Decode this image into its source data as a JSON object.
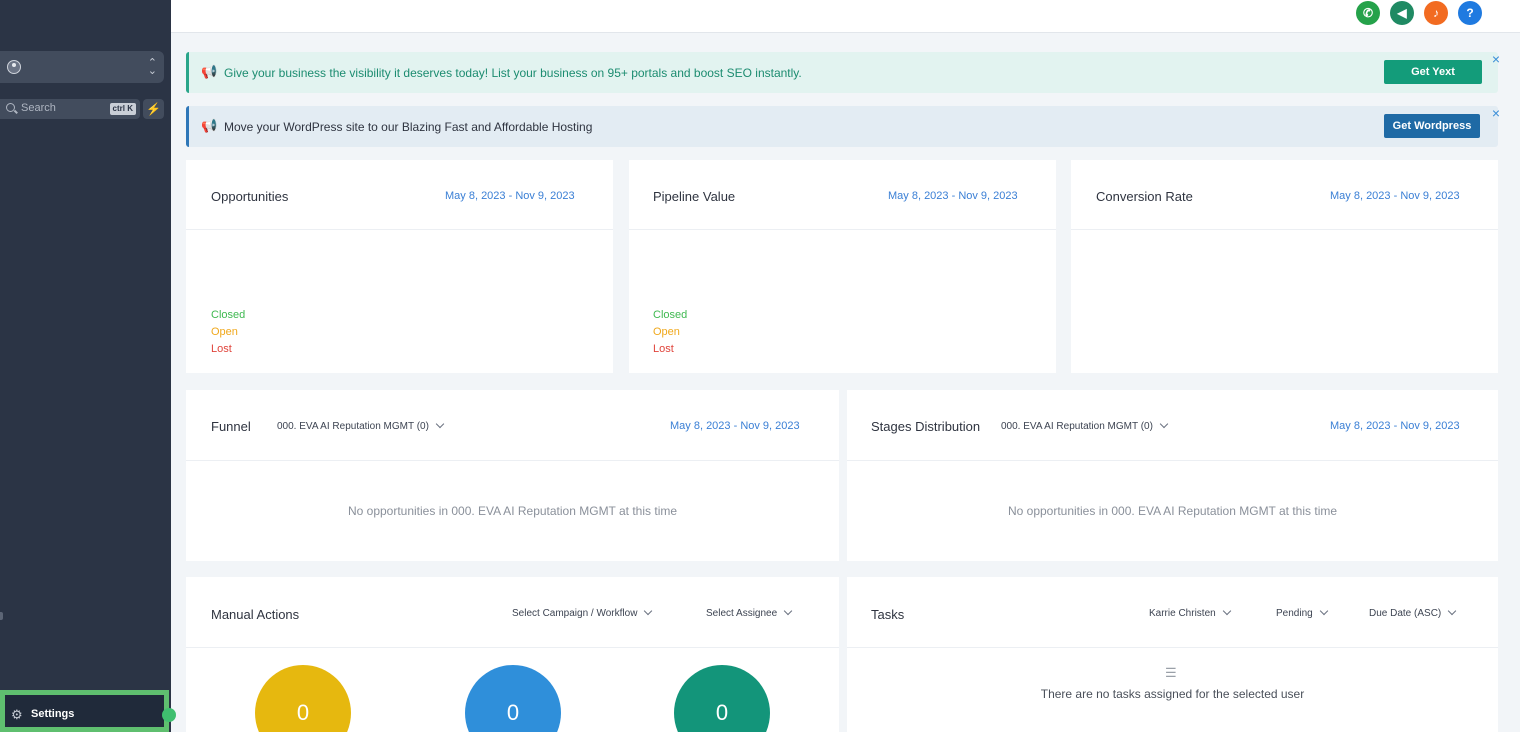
{
  "sidebar": {
    "search_label": "Search",
    "search_shortcut": "ctrl K",
    "settings_label": "Settings"
  },
  "header": {
    "icons": [
      "phone-icon",
      "megaphone-icon",
      "bell-icon",
      "help-icon"
    ],
    "help_glyph": "?"
  },
  "banners": {
    "yext_text": "Give your business the visibility it deserves today! List your business on 95+ portals and boost SEO instantly.",
    "yext_button": "Get Yext",
    "wordpress_text": "Move your WordPress site to our Blazing Fast and Affordable Hosting",
    "wordpress_button": "Get Wordpress",
    "close_glyph": "×"
  },
  "opportunities": {
    "title": "Opportunities",
    "date_range": "May 8, 2023 - Nov 9, 2023",
    "legend": [
      "Closed",
      "Open",
      "Lost"
    ]
  },
  "pipeline_value": {
    "title": "Pipeline Value",
    "date_range": "May 8, 2023 - Nov 9, 2023",
    "legend": [
      "Closed",
      "Open",
      "Lost"
    ]
  },
  "conversion_rate": {
    "title": "Conversion Rate",
    "date_range": "May 8, 2023 - Nov 9, 2023"
  },
  "funnel": {
    "title": "Funnel",
    "pipeline_select": "000. EVA AI Reputation MGMT (0)",
    "date_range": "May 8, 2023 - Nov 9, 2023",
    "empty_message": "No opportunities in 000. EVA AI Reputation MGMT at this time"
  },
  "stages_distribution": {
    "title": "Stages Distribution",
    "pipeline_select": "000. EVA AI Reputation MGMT (0)",
    "date_range": "May 8, 2023 - Nov 9, 2023",
    "empty_message": "No opportunities in 000. EVA AI Reputation MGMT at this time"
  },
  "manual_actions": {
    "title": "Manual Actions",
    "campaign_select": "Select Campaign / Workflow",
    "assignee_select": "Select Assignee",
    "counts": [
      "0",
      "0",
      "0"
    ]
  },
  "tasks": {
    "title": "Tasks",
    "user_select": "Karrie Christen",
    "status_select": "Pending",
    "sort_select": "Due Date (ASC)",
    "empty_message": "There are no tasks assigned for the selected user"
  },
  "colors": {
    "sidebar_bg": "#2b3445",
    "closed": "#3fb950",
    "open": "#f0a81c",
    "lost": "#e0443b",
    "date_link": "#3a7fd5",
    "yext_green": "#139c7a",
    "wordpress_blue": "#1f6aa5",
    "circle_yellow": "#e6b80f",
    "circle_blue": "#2f8fda",
    "circle_green": "#13957a"
  }
}
